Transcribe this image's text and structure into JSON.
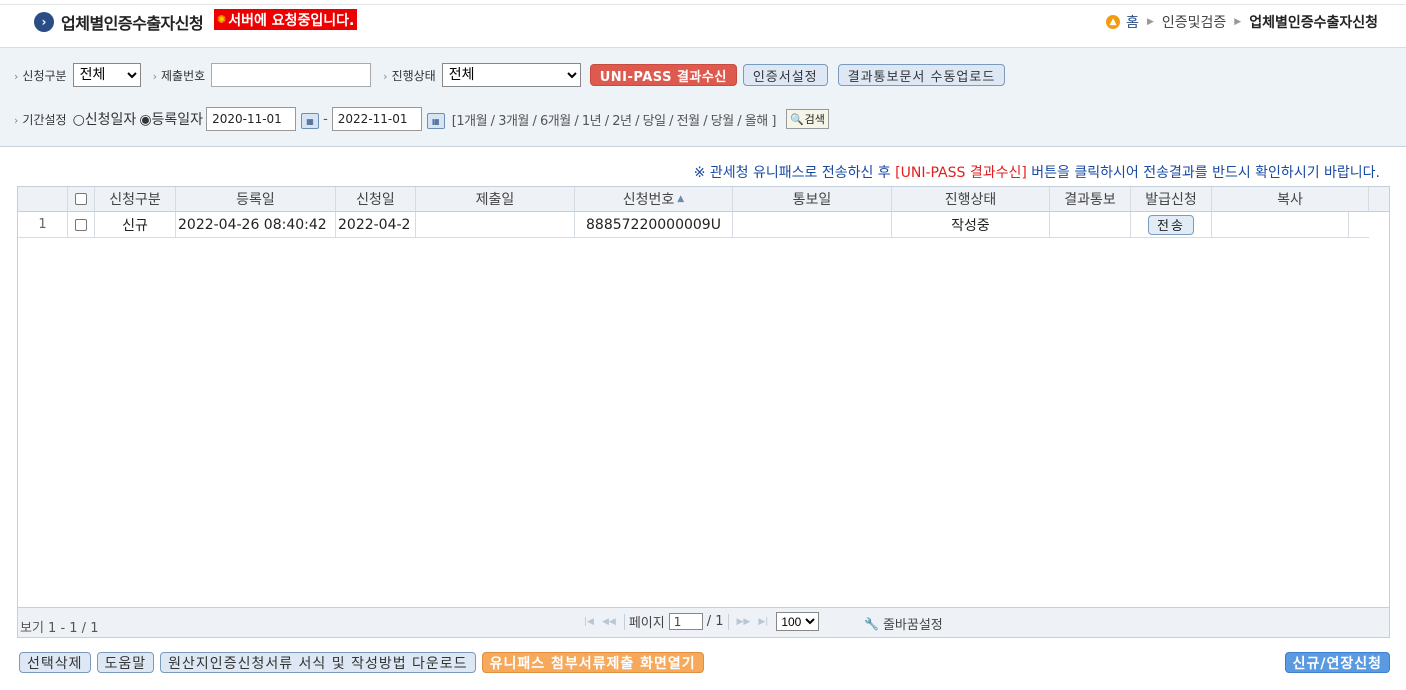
{
  "header": {
    "title": "업체별인증수출자신청",
    "loading_text": "서버에 요청중입니다.",
    "icon": "chevron-right-circle-icon"
  },
  "breadcrumb": {
    "home": "홈",
    "level1": "인증및검증",
    "current": "업체별인증수출자신청"
  },
  "search": {
    "type_label": "신청구분",
    "type_value": "전체",
    "submit_no_label": "제출번호",
    "submit_no_value": "",
    "status_label": "진행상태",
    "status_value": "전체",
    "unipass_button": "UNI-PASS 결과수신",
    "cert_button": "인증서설정",
    "upload_button": "결과통보문서 수동업로드",
    "period_label": "기간설정",
    "radio_apply": "○신청일자",
    "radio_register": "◉등록일자",
    "date_from": "2020-11-01",
    "date_sep": "-",
    "date_to": "2022-11-01",
    "period_links": "[1개월 / 3개월 / 6개월 / 1년 / 2년 / 당일 / 전월 / 당월 / 올해 ]",
    "search_button": "검색"
  },
  "notice": {
    "prefix": "※ 관세청 유니패스로 전송하신 후 ",
    "highlight": "[UNI-PASS 결과수신]",
    "suffix": " 버튼을 클릭하시어 전송결과를 반드시 확인하시기 바랍니다."
  },
  "grid": {
    "columns": [
      "",
      "",
      "신청구분",
      "등록일",
      "신청일",
      "제출일",
      "신청번호",
      "통보일",
      "진행상태",
      "결과통보",
      "발급신청",
      "복사"
    ],
    "rows": [
      {
        "num": "1",
        "type": "신규",
        "registered": "2022-04-26 08:40:42",
        "applied": "2022-04-2",
        "submitted": "",
        "apply_no": "88857220000009U",
        "notified": "",
        "status": "작성중",
        "result": "",
        "issue_button": "전송",
        "copy": ""
      }
    ],
    "footer": {
      "view_text": "보기 1 - 1 / 1",
      "page_label": "페이지",
      "page_value": "1",
      "page_total": "/ 1",
      "rows_per_page": "100",
      "wrap_setting": "줄바꿈설정"
    }
  },
  "bottom_buttons": {
    "delete": "선택삭제",
    "help": "도움말",
    "download": "원산지인증신청서류 서식 및 작성방법 다운로드",
    "unipass_open": "유니패스 첨부서류제출 화면열기",
    "new_apply": "신규/연장신청"
  }
}
